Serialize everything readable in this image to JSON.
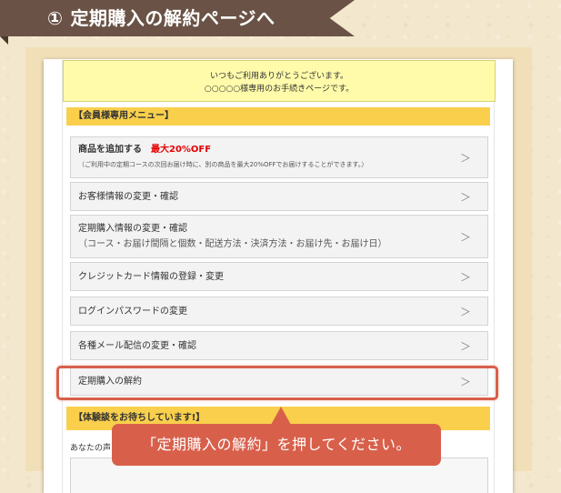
{
  "banner": {
    "step": "①",
    "title": "定期購入の解約ページへ"
  },
  "welcome": {
    "line1": "いつもご利用ありがとうございます。",
    "line2": "○○○○○様専用のお手続きページです。"
  },
  "member_menu": {
    "heading": "【会員様専用メニュー】",
    "items": [
      {
        "label": "商品を追加する",
        "promo": "最大20%OFF",
        "sub": "（ご利用中の定期コースの次回お届け時に、別の商品を最大20%OFFでお届けすることができます。）"
      },
      {
        "label": "お客様情報の変更・確認"
      },
      {
        "label": "定期購入情報の変更・確認",
        "sub": "（コース・お届け間隔と個数・配送方法・決済方法・お届け先・お届け日）"
      },
      {
        "label": "クレジットカード情報の登録・変更"
      },
      {
        "label": "ログインパスワードの変更"
      },
      {
        "label": "各種メール配信の変更・確認"
      },
      {
        "label": "定期購入の解約"
      }
    ],
    "chevron": "＞"
  },
  "testimonial": {
    "heading": "【体験談をお待ちしています!】",
    "text": "あなたの声"
  },
  "callout": {
    "text": "「定期購入の解約」を押してください。"
  },
  "colors": {
    "banner": "#6a5346",
    "welcome_bg": "#fffbaa",
    "section_head": "#f9cf4c",
    "highlight": "#d85f4b",
    "promo": "#e40000"
  }
}
